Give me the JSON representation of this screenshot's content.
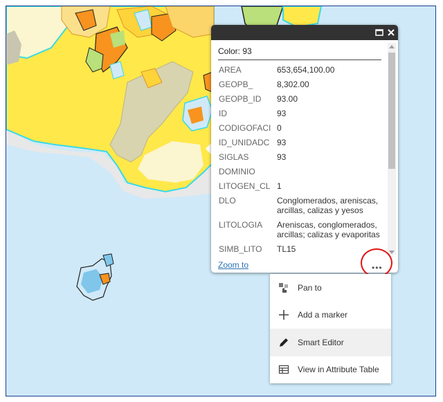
{
  "popup": {
    "title": "Color: 93",
    "attributes": [
      {
        "key": "AREA",
        "value": "653,654,100.00"
      },
      {
        "key": "GEOPB_",
        "value": "8,302.00"
      },
      {
        "key": "GEOPB_ID",
        "value": "93.00"
      },
      {
        "key": "ID",
        "value": "93"
      },
      {
        "key": "CODIGOFACI",
        "value": "0"
      },
      {
        "key": "ID_UNIDADC",
        "value": "93"
      },
      {
        "key": "SIGLAS",
        "value": "93"
      },
      {
        "key": "DOMINIO",
        "value": ""
      },
      {
        "key": "LITOGEN_CL",
        "value": "1"
      },
      {
        "key": "DLO",
        "value": "Conglomerados, areniscas, arcillas, calizas y yesos"
      },
      {
        "key": "LITOLOGIA",
        "value": "Areniscas, conglomerados, arcillas; calizas y evaporitas"
      },
      {
        "key": "SIMB_LITO",
        "value": "TL15"
      }
    ],
    "zoom_link": "Zoom to",
    "more_label": "•••",
    "maximize_icon": "maximize-icon",
    "close_icon": "close-icon"
  },
  "menu": {
    "items": [
      {
        "label": "Pan to",
        "icon": "pan-icon"
      },
      {
        "label": "Add a marker",
        "icon": "plus-icon"
      },
      {
        "label": "Smart Editor",
        "icon": "pencil-icon"
      },
      {
        "label": "View in Attribute Table",
        "icon": "table-icon"
      }
    ]
  },
  "colors": {
    "sea": "#cfe9f8",
    "yellow_unit": "#ffe84a",
    "tan_unit": "#d8d4b0",
    "cream_unit": "#fbf6cf",
    "orange_unit": "#f7931e",
    "highlight_outline": "#3ad9e6",
    "red_circle": "#e01515"
  }
}
